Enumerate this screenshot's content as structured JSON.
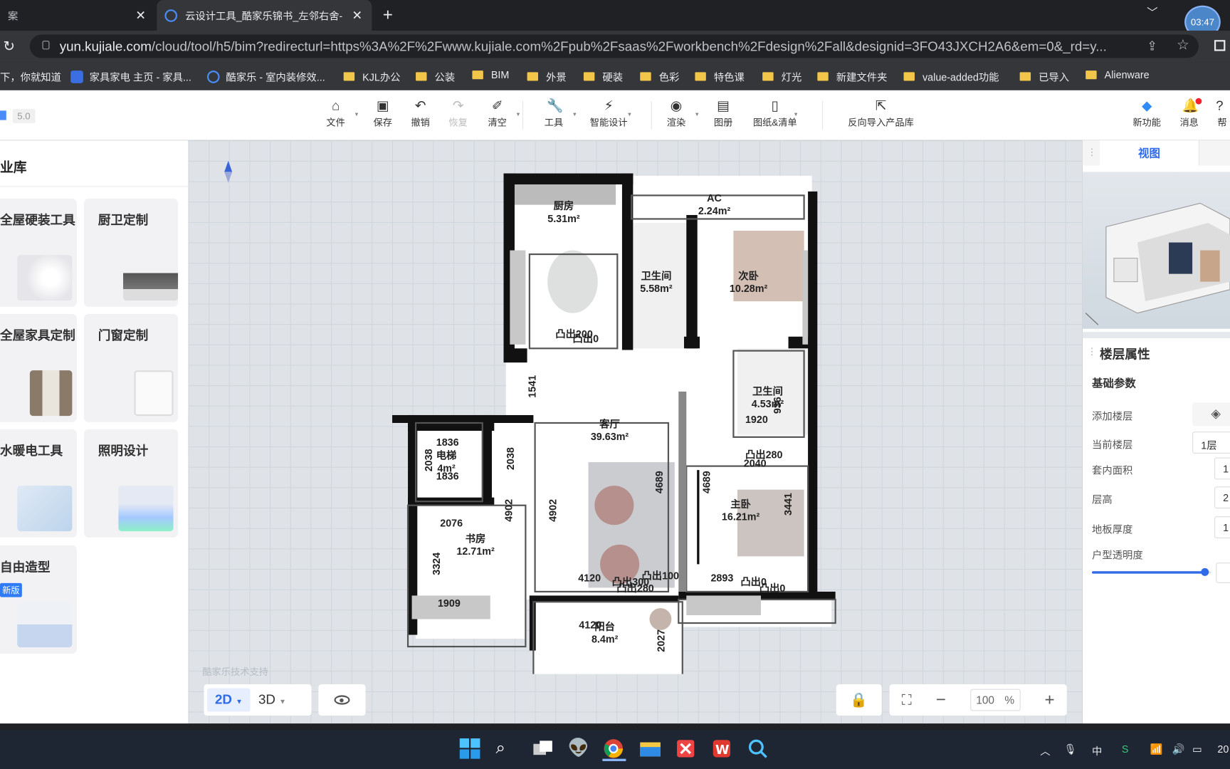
{
  "browser": {
    "tabs": [
      {
        "label": "案",
        "active": false
      },
      {
        "label": "云设计工具_酷家乐锦书_左邻右舍-",
        "active": true
      }
    ],
    "new_tab": "+",
    "avatar_time": "03:47",
    "url_host": "yun.kujiale.com",
    "url_path": "/cloud/tool/h5/bim?redirecturl=https%3A%2F%2Fwww.kujiale.com%2Fpub%2Fsaas%2Fworkbench%2Fdesign%2Fall&designid=3FO43JXCH2A6&em=0&_rd=y...",
    "bookmarks": [
      {
        "label": "下，你就知道",
        "icon": "none"
      },
      {
        "label": "家具家电 主页 - 家具...",
        "icon": "jj"
      },
      {
        "label": "酷家乐 - 室内装修效...",
        "icon": "kjl"
      },
      {
        "label": "KJL办公",
        "icon": "folder"
      },
      {
        "label": "公装",
        "icon": "folder"
      },
      {
        "label": "BIM",
        "icon": "folder"
      },
      {
        "label": "外景",
        "icon": "folder"
      },
      {
        "label": "硬装",
        "icon": "folder"
      },
      {
        "label": "色彩",
        "icon": "folder"
      },
      {
        "label": "特色课",
        "icon": "folder"
      },
      {
        "label": "灯光",
        "icon": "folder"
      },
      {
        "label": "新建文件夹",
        "icon": "folder"
      },
      {
        "label": "value-added功能",
        "icon": "folder"
      },
      {
        "label": "已导入",
        "icon": "folder"
      },
      {
        "label": "Alienware",
        "icon": "folder"
      }
    ]
  },
  "app": {
    "version": "5.0",
    "toolbar": [
      {
        "label": "文件",
        "icon": "home-icon",
        "enabled": true
      },
      {
        "label": "保存",
        "icon": "save-icon",
        "enabled": true
      },
      {
        "label": "撤销",
        "icon": "undo-icon",
        "enabled": true
      },
      {
        "label": "恢复",
        "icon": "redo-icon",
        "enabled": false
      },
      {
        "label": "清空",
        "icon": "eraser-icon",
        "enabled": true
      },
      {
        "label": "工具",
        "icon": "wrench-icon",
        "enabled": true
      },
      {
        "label": "智能设计",
        "icon": "lightning-icon",
        "enabled": true
      },
      {
        "label": "渲染",
        "icon": "camera-icon",
        "enabled": true
      },
      {
        "label": "图册",
        "icon": "album-icon",
        "enabled": true
      },
      {
        "label": "图纸&清单",
        "icon": "document-icon",
        "enabled": true
      },
      {
        "label": "反向导入产品库",
        "icon": "import-icon",
        "enabled": true
      }
    ],
    "right_tools": [
      {
        "label": "新功能",
        "icon": "new-feature-icon"
      },
      {
        "label": "消息",
        "icon": "bell-icon"
      },
      {
        "label": "帮",
        "icon": "help-icon"
      }
    ]
  },
  "left_panel": {
    "title": "业库",
    "cards": [
      {
        "title": "全屋硬装工具"
      },
      {
        "title": "厨卫定制"
      },
      {
        "title": "全屋家具定制"
      },
      {
        "title": "门窗定制"
      },
      {
        "title": "水暖电工具"
      },
      {
        "title": "照明设计"
      },
      {
        "title": "自由造型",
        "badge": "新版"
      }
    ]
  },
  "floorplan": {
    "rooms": [
      {
        "name": "厨房",
        "area": "5.31m²"
      },
      {
        "name": "AC",
        "area": "2.24m²"
      },
      {
        "name": "卫生间",
        "area": "5.58m²"
      },
      {
        "name": "次卧",
        "area": "10.28m²"
      },
      {
        "name": "卫生间",
        "area": "4.53m²"
      },
      {
        "name": "客厅",
        "area": "39.63m²"
      },
      {
        "name": "电梯",
        "area": "4m²"
      },
      {
        "name": "书房",
        "area": "12.71m²"
      },
      {
        "name": "主卧",
        "area": "16.21m²"
      },
      {
        "name": "阳台",
        "area": "8.4m²"
      }
    ],
    "dims": [
      "1541",
      "2038",
      "4902",
      "4902",
      "4689",
      "4689",
      "3441",
      "2076",
      "3324",
      "1909",
      "1836",
      "1836",
      "2038",
      "4120",
      "4120",
      "2027",
      "2893",
      "2040",
      "1920",
      "凸出200",
      "凸出0",
      "凸出280",
      "凸出300",
      "凸出100",
      "凸出280",
      "凸出0",
      "凸出0",
      "936"
    ],
    "watermark": "酷家乐技术支持"
  },
  "bottom": {
    "view2d": "2D",
    "view3d": "3D",
    "zoom": "100",
    "zoom_unit": "%"
  },
  "right_panel": {
    "tab": "视图",
    "section": "楼层属性",
    "subsection": "基础参数",
    "props": [
      {
        "label": "添加楼层",
        "value": ""
      },
      {
        "label": "当前楼层",
        "value": "1层"
      },
      {
        "label": "套内面积",
        "value": "1"
      },
      {
        "label": "层高",
        "value": "2"
      },
      {
        "label": "地板厚度",
        "value": "1"
      },
      {
        "label": "户型透明度",
        "value": ""
      }
    ],
    "transparency": 0.95
  },
  "taskbar": {
    "ime": "中",
    "clock": "20"
  },
  "colors": {
    "accent": "#2f6be8",
    "wall": "#111111"
  }
}
